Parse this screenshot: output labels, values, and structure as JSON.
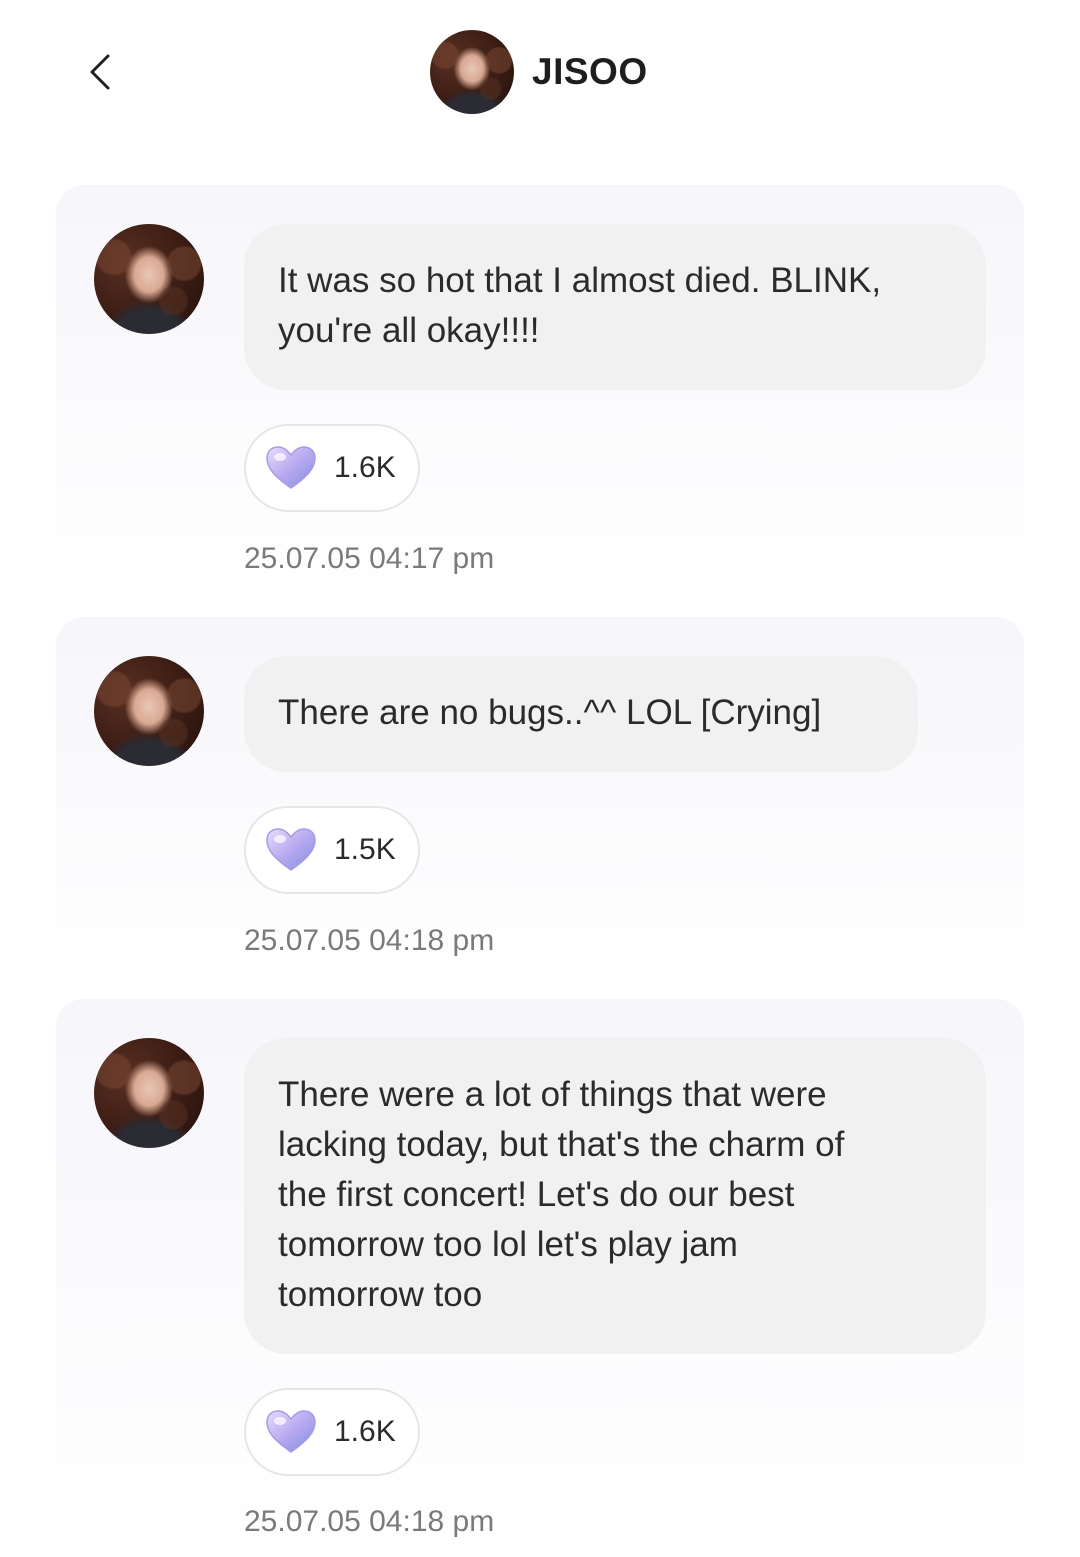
{
  "header": {
    "name": "JISOO"
  },
  "posts": [
    {
      "text": "It was so hot that I almost died. BLINK,\nyou're all okay!!!!",
      "likes": "1.6K",
      "timestamp": "25.07.05 04:17 pm"
    },
    {
      "text": "There are no bugs..^^ LOL [Crying]",
      "likes": "1.5K",
      "timestamp": "25.07.05 04:18 pm"
    },
    {
      "text": "There were a lot of things that were\nlacking today, but that's the charm of\nthe first concert! Let's do our best\ntomorrow too lol let's play jam\ntomorrow too",
      "likes": "1.6K",
      "timestamp": "25.07.05 04:18 pm"
    }
  ],
  "icons": {
    "back": "chevron-left-icon",
    "like": "heart-icon"
  },
  "colors": {
    "bubble": "#f1f1f1",
    "heart_gradient_start": "#c9b8f2",
    "heart_gradient_end": "#7f8fe0",
    "timestamp": "#7a7a7a"
  }
}
